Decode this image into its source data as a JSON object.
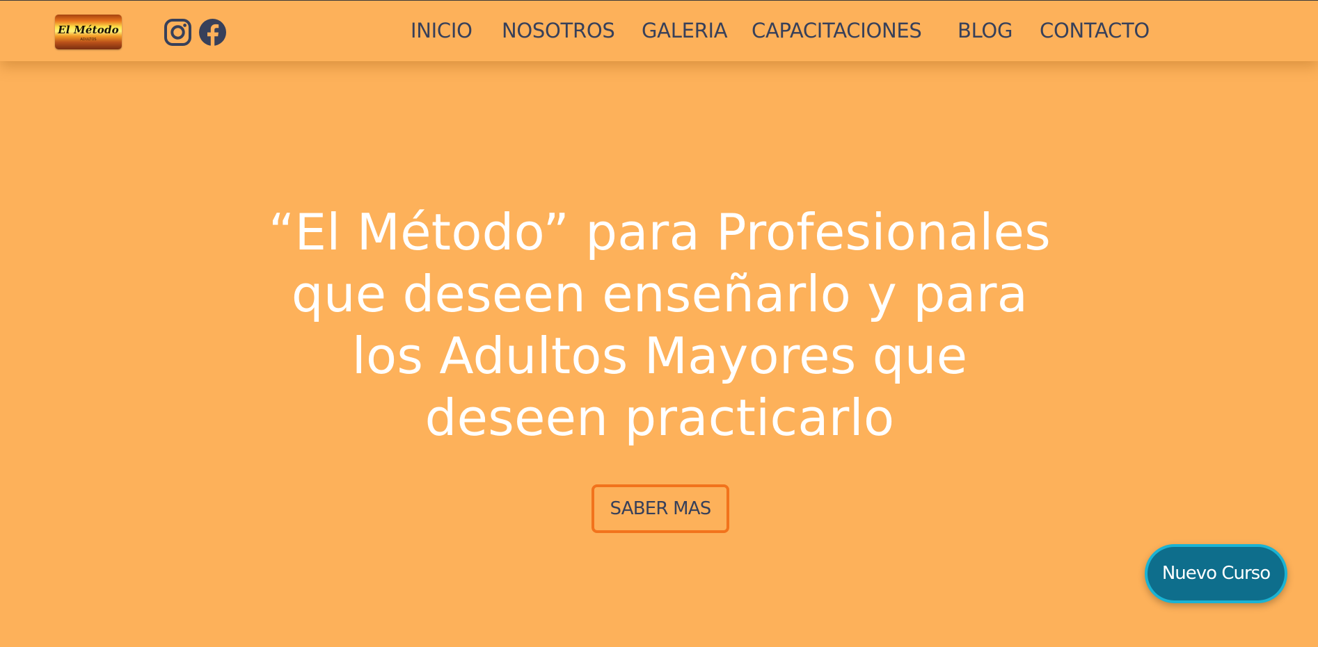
{
  "header": {
    "logo": {
      "text": "El Método",
      "subtext": "ADULTOS"
    },
    "social": {
      "instagram_icon": "instagram-icon",
      "facebook_icon": "facebook-icon"
    },
    "nav": {
      "inicio": "INICIO",
      "nosotros": "NOSOTROS",
      "galeria": "GALERIA",
      "capacitaciones": "CAPACITACIONES",
      "blog": "BLOG",
      "contacto": "CONTACTO"
    }
  },
  "hero": {
    "title_line1": "“El Método” para Profesionales",
    "title_line2": "que deseen enseñarlo y para",
    "title_line3": "los Adultos Mayores que",
    "title_line4": "deseen practicarlo",
    "cta_label": "SABER MAS"
  },
  "floating": {
    "label": "Nuevo Curso"
  },
  "colors": {
    "background": "#FDB15A",
    "nav_text": "#37405a",
    "cta_border": "#F2731C",
    "floating_bg": "#0E6E8C",
    "floating_border": "#1BB3D3"
  }
}
